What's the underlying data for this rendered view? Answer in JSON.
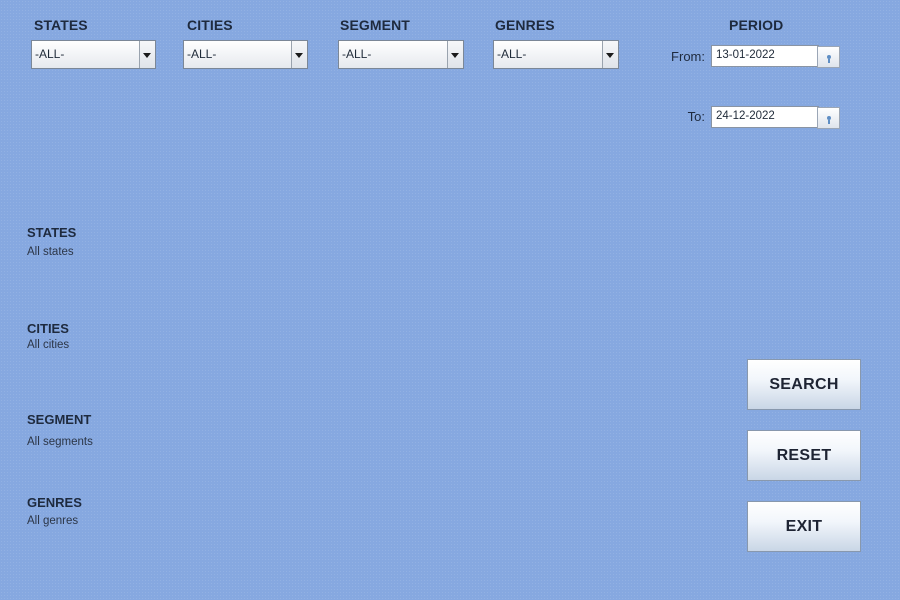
{
  "filters": {
    "states": {
      "label": "STATES",
      "value": "-ALL-"
    },
    "cities": {
      "label": "CITIES",
      "value": "-ALL-"
    },
    "segment": {
      "label": "SEGMENT",
      "value": "-ALL-"
    },
    "genres": {
      "label": "GENRES",
      "value": "-ALL-"
    }
  },
  "period": {
    "title": "PERIOD",
    "from_label": "From:",
    "from_value": "13-01-2022",
    "to_label": "To:",
    "to_value": "24-12-2022",
    "picker_icon": "calendar-picker-icon"
  },
  "summary": {
    "states": {
      "title": "STATES",
      "value": "All states"
    },
    "cities": {
      "title": "CITIES",
      "value": "All cities"
    },
    "segment": {
      "title": "SEGMENT",
      "value": "All segments"
    },
    "genres": {
      "title": "GENRES",
      "value": "All genres"
    }
  },
  "actions": {
    "search": "SEARCH",
    "reset": "RESET",
    "exit": "EXIT"
  },
  "colors": {
    "background": "#86a8e0",
    "label_text": "#1e2a3e"
  }
}
